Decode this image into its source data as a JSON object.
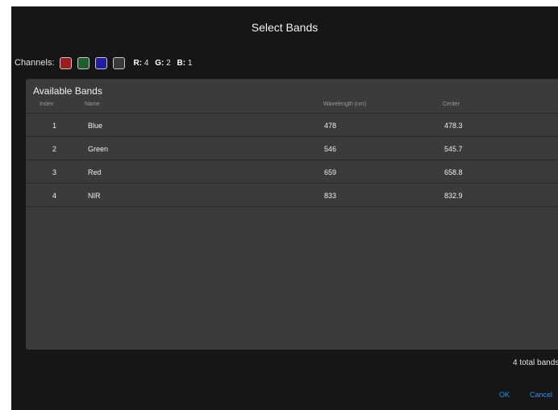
{
  "dialog": {
    "title": "Select Bands"
  },
  "channels": {
    "label": "Channels:",
    "swatches": [
      {
        "name": "red",
        "color": "#9a1e1e"
      },
      {
        "name": "green",
        "color": "#1d5e2a"
      },
      {
        "name": "blue",
        "color": "#1f1fa0"
      },
      {
        "name": "gray",
        "color": "#3a3a3a"
      }
    ],
    "mapping": {
      "r_label": "R:",
      "r_value": "4",
      "g_label": "G:",
      "g_value": "2",
      "b_label": "B:",
      "b_value": "1"
    }
  },
  "bands_panel": {
    "title": "Available Bands",
    "columns": {
      "index": "Index",
      "name": "Name",
      "wavelength": "Wavelength (nm)",
      "center": "Center"
    },
    "rows": [
      {
        "index": "1",
        "name": "Blue",
        "wavelength": "478",
        "center": "478.3"
      },
      {
        "index": "2",
        "name": "Green",
        "wavelength": "546",
        "center": "545.7"
      },
      {
        "index": "3",
        "name": "Red",
        "wavelength": "659",
        "center": "658.8"
      },
      {
        "index": "4",
        "name": "NIR",
        "wavelength": "833",
        "center": "832.9"
      }
    ]
  },
  "footer": {
    "total": "4 total bands",
    "ok_label": "OK",
    "cancel_label": "Cancel"
  },
  "colors": {
    "dialog_bg": "#161616",
    "panel_bg": "#3b3b3b",
    "accent": "#2f8ee8"
  }
}
